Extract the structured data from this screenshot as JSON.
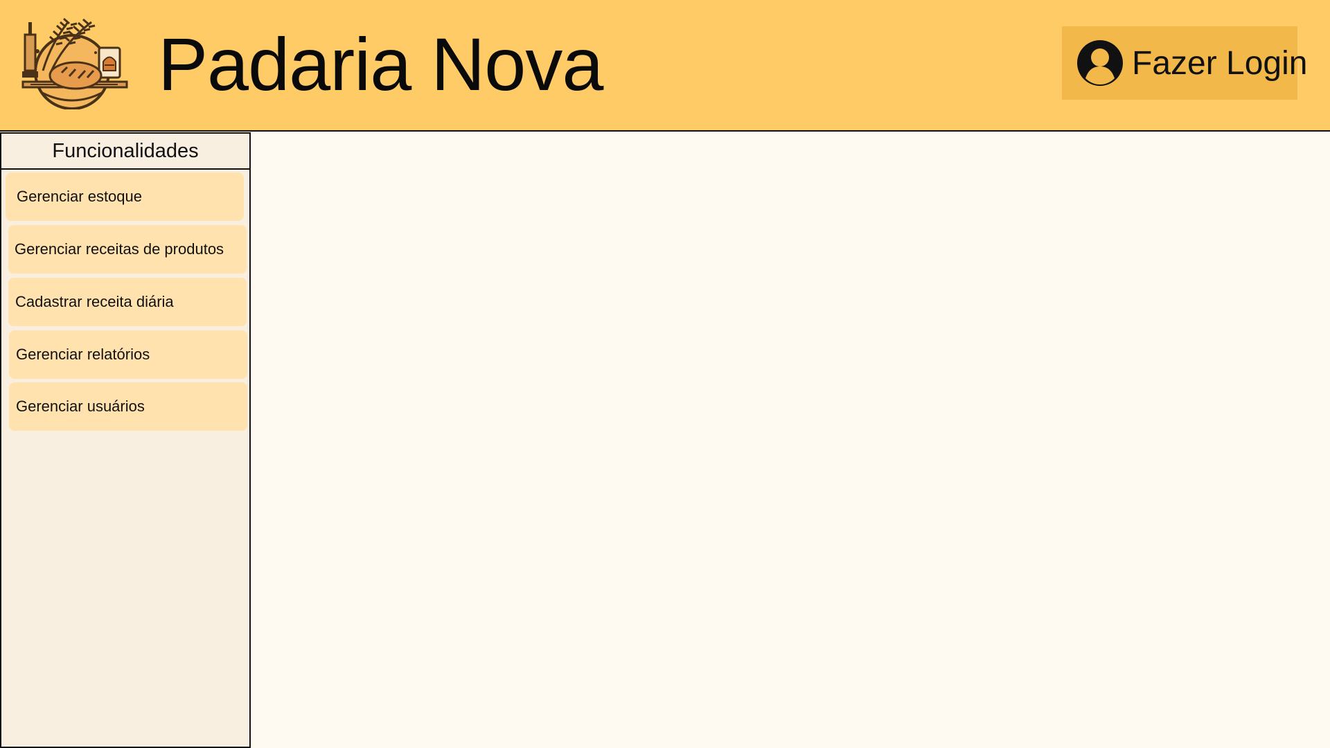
{
  "header": {
    "title": "Padaria Nova",
    "logo_icon": "bakery-logo-icon",
    "login_button": {
      "label": "Fazer Login",
      "icon": "user-avatar-icon"
    }
  },
  "sidebar": {
    "title": "Funcionalidades",
    "items": [
      {
        "label": "Gerenciar estoque"
      },
      {
        "label": "Gerenciar receitas de produtos"
      },
      {
        "label": "Cadastrar receita diária"
      },
      {
        "label": "Gerenciar relatórios"
      },
      {
        "label": "Gerenciar usuários"
      }
    ]
  },
  "colors": {
    "header_bg": "#ffcb67",
    "login_button_bg": "#f2b84a",
    "sidebar_bg": "#f8efe0",
    "sidebar_item_bg": "#ffe2ae",
    "content_bg": "#fffaf1"
  }
}
